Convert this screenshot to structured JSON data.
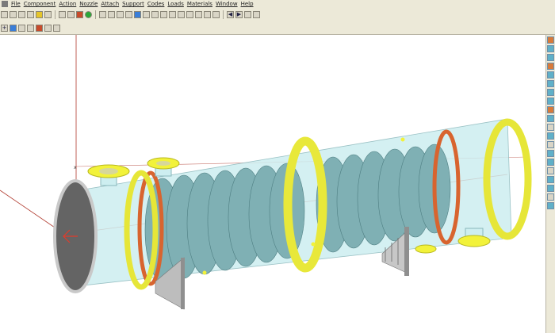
{
  "menu": {
    "items": [
      "File",
      "Component",
      "Action",
      "Nozzle",
      "Attach",
      "Support",
      "Codes",
      "Loads",
      "Materials",
      "Window",
      "Help"
    ]
  },
  "toolbar_icons": [
    "new-icon",
    "open-icon",
    "save-icon",
    "print-icon",
    "undo-icon",
    "zoom-icon",
    "status-green-icon",
    "view-icon",
    "render-icon",
    "layer-icon",
    "arrow-left-icon",
    "arrow-right-icon"
  ],
  "right_toolbar_icons": [
    "vessel-head-icon",
    "shell-icon",
    "cone-icon",
    "nozzle-icon",
    "flange-icon",
    "saddle-icon",
    "ring-icon",
    "lug-icon"
  ],
  "colors": {
    "shell": "#cdeef0",
    "baffle": "#7fb0b4",
    "flange": "#f2f23a",
    "gasket": "#d8642f",
    "tubesheet": "#666666",
    "axis": "#c0392b"
  }
}
